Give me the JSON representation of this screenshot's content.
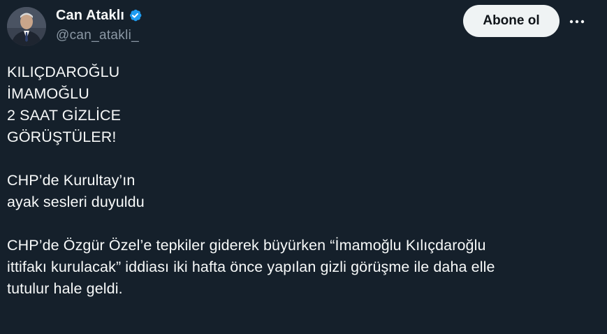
{
  "author": {
    "display_name": "Can Ataklı",
    "handle": "@can_atakli_",
    "verified": true,
    "avatar_icon": "profile-photo"
  },
  "actions": {
    "follow_label": "Abone ol",
    "more_icon": "more-horizontal-icon"
  },
  "tweet": {
    "paragraphs": [
      [
        "KILIÇDAROĞLU",
        "İMAMOĞLU",
        "2 SAAT GİZLİCE",
        "GÖRÜŞTÜLER!"
      ],
      [
        "CHP’de Kurultay’ın",
        "ayak sesleri duyuldu"
      ],
      [
        "CHP’de Özgür Özel’e tepkiler giderek büyürken “İmamoğlu Kılıçdaroğlu",
        "ittifakı kurulacak” iddiası iki hafta önce yapılan gizli görüşme ile daha elle",
        "tutulur hale geldi."
      ]
    ]
  },
  "colors": {
    "background": "#15202b",
    "text_primary": "#f7f9f9",
    "text_secondary": "#8b98a5",
    "verified_badge": "#1d9bf0",
    "follow_button_bg": "#eff3f4"
  }
}
